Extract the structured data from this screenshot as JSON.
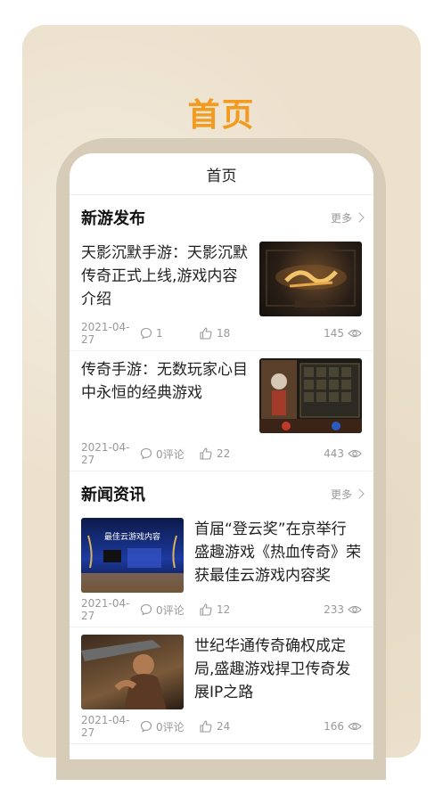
{
  "hero_title": "首页",
  "nav_title": "首页",
  "sections": [
    {
      "title": "新游发布",
      "more_label": "更多",
      "articles": [
        {
          "title": "天影沉默手游：天影沉默传奇正式上线,游戏内容介绍",
          "date": "2021-04-27",
          "comments": "1",
          "likes": "18",
          "views": "145",
          "thumb": "game-logo-thumbnail"
        },
        {
          "title": "传奇手游：无数玩家心目中永恒的经典游戏",
          "date": "2021-04-27",
          "comments": "0评论",
          "likes": "22",
          "views": "443",
          "thumb": "game-inventory-thumbnail"
        }
      ]
    },
    {
      "title": "新闻资讯",
      "more_label": "更多",
      "articles": [
        {
          "title": "首届“登云奖”在京举行 盛趣游戏《热血传奇》荣获最佳云游戏内容奖",
          "date": "2021-04-27",
          "comments": "0评论",
          "likes": "12",
          "views": "233",
          "thumb": "award-stage-thumbnail",
          "thumb_text": "最佳云游戏内容"
        },
        {
          "title": "世纪华通传奇确权成定局,盛趣游戏捍卫传奇发展IP之路",
          "date": "2021-04-27",
          "comments": "0评论",
          "likes": "24",
          "views": "166",
          "thumb": "warrior-thumbnail"
        }
      ]
    }
  ],
  "colors": {
    "accent": "#f39b1e",
    "card_bg": "#ece1cd",
    "frame": "#d7ccb8"
  }
}
